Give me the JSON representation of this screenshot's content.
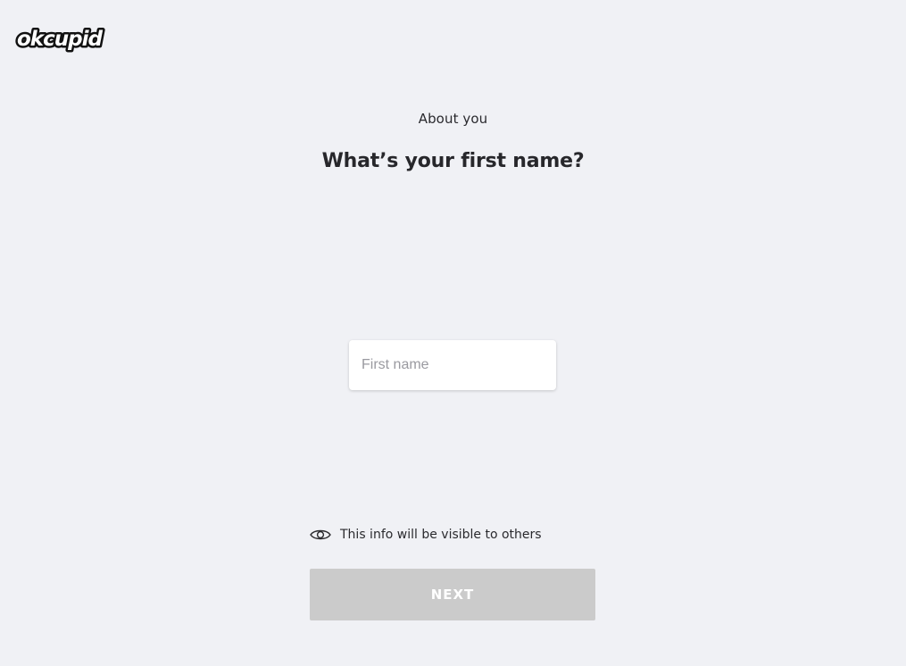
{
  "brand": {
    "logo_text": "okcupid"
  },
  "header": {
    "section_label": "About you",
    "question": "What’s your first name?"
  },
  "form": {
    "first_name": {
      "value": "",
      "placeholder": "First name"
    }
  },
  "visibility": {
    "icon": "eye-icon",
    "text": "This info will be visible to others"
  },
  "actions": {
    "next_label": "NEXT"
  },
  "colors": {
    "background": "#f0f1f5",
    "button_disabled": "#cbcbcb",
    "text": "#2a2a2e"
  }
}
